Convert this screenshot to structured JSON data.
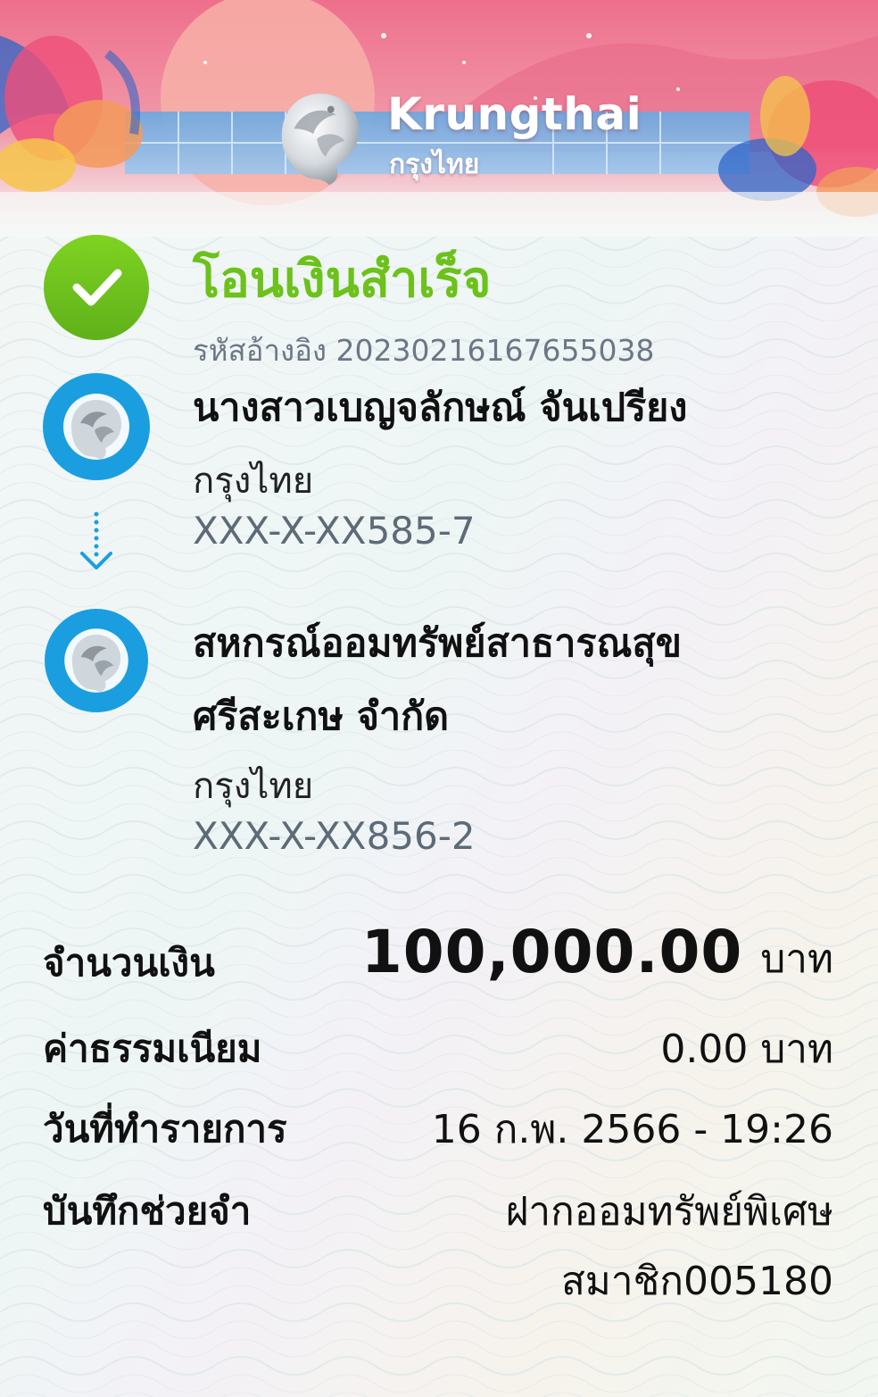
{
  "brand": {
    "name_en": "Krungthai",
    "name_th": "กรุงไทย",
    "colors": {
      "primary_blue": "#1b9ee0",
      "success_green": "#6cc11b",
      "banner_pink": "#ef7f9a"
    }
  },
  "status": {
    "icon": "check-circle-icon",
    "title": "โอนเงินสำเร็จ",
    "reference": "รหัสอ้างอิง 2023021616765503​8"
  },
  "sender": {
    "icon": "krungthai-logo-icon",
    "name": "นางสาวเบญจลักษณ์ จันเปรียง",
    "bank": "กรุงไทย",
    "account": "XXX-X-XX585-7"
  },
  "transfer_arrow_icon": "arrow-down-dotted-icon",
  "receiver": {
    "icon": "krungthai-logo-icon",
    "name_line1": "สหกรณ์ออมทรัพย์สาธารณสุข",
    "name_line2": "ศรีสะเกษ จำกัด",
    "bank": "กรุงไทย",
    "account": "XXX-X-XX856-2"
  },
  "details": {
    "amount_label": "จำนวนเงิน",
    "amount_value": "100,000.00",
    "amount_unit": "บาท",
    "fee_label": "ค่าธรรมเนียม",
    "fee_value": "0.00 บาท",
    "date_label": "วันที่ทำรายการ",
    "date_value": "16 ก.พ. 2566 - 19:26",
    "memo_label": "บันทึกช่วยจำ",
    "memo_line1": "ฝากออมทรัพย์พิเศษ",
    "memo_line2": "สมาชิก005180"
  }
}
